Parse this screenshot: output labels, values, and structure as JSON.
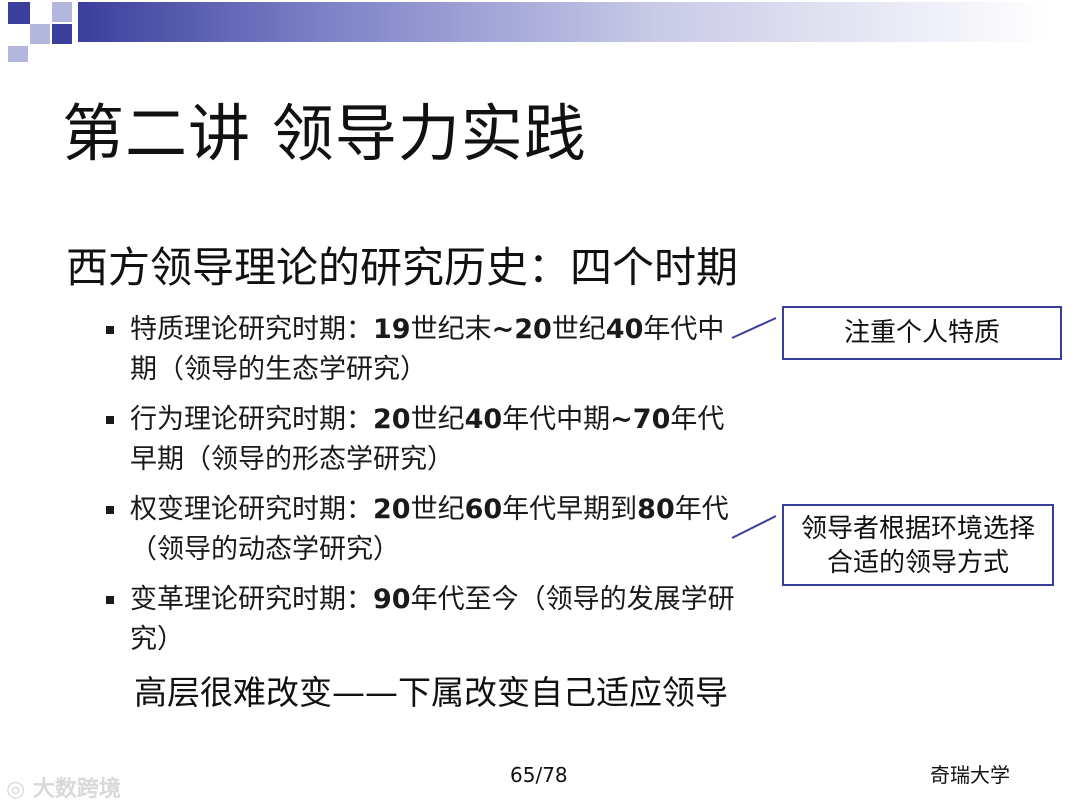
{
  "header": {
    "title": "第二讲  领导力实践",
    "subtitle": "西方领导理论的研究历史：四个时期"
  },
  "bullets": [
    {
      "parts": [
        {
          "t": "特质理论研究时期：",
          "b": false
        },
        {
          "t": "19",
          "b": true
        },
        {
          "t": "世纪末",
          "b": false
        },
        {
          "t": "~20",
          "b": true
        },
        {
          "t": "世纪",
          "b": false
        },
        {
          "t": "40",
          "b": true
        },
        {
          "t": "年代中期（领导的生态学研究）",
          "b": false
        }
      ]
    },
    {
      "parts": [
        {
          "t": "行为理论研究时期：",
          "b": false
        },
        {
          "t": "20",
          "b": true
        },
        {
          "t": "世纪",
          "b": false
        },
        {
          "t": "40",
          "b": true
        },
        {
          "t": "年代中期",
          "b": false
        },
        {
          "t": "~70",
          "b": true
        },
        {
          "t": "年代早期（领导的形态学研究）",
          "b": false
        }
      ]
    },
    {
      "parts": [
        {
          "t": "权变理论研究时期：",
          "b": false
        },
        {
          "t": "20",
          "b": true
        },
        {
          "t": "世纪",
          "b": false
        },
        {
          "t": "60",
          "b": true
        },
        {
          "t": "年代早期到",
          "b": false
        },
        {
          "t": "80",
          "b": true
        },
        {
          "t": "年代（领导的动态学研究）",
          "b": false
        }
      ]
    },
    {
      "parts": [
        {
          "t": "变革理论研究时期：",
          "b": false
        },
        {
          "t": "90",
          "b": true
        },
        {
          "t": "年代至今（领导的发展学研究）",
          "b": false
        }
      ]
    }
  ],
  "callouts": {
    "first": "注重个人特质",
    "second_line1": "领导者根据环境选择",
    "second_line2": "合适的领导方式"
  },
  "conclusion": "高层很难改变——下属改变自己适应领导",
  "footer": {
    "page": "65/78",
    "org": "奇瑞大学",
    "watermark": "大数跨境"
  },
  "colors": {
    "accent": "#3b3f9c"
  }
}
